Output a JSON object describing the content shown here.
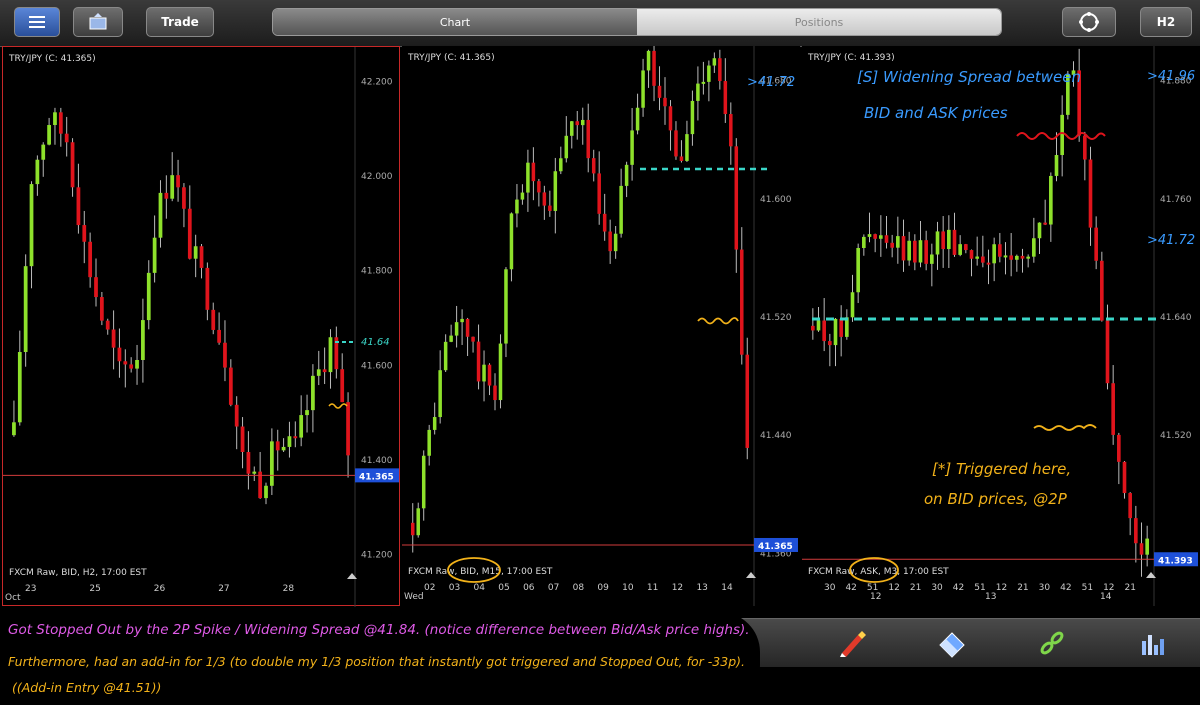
{
  "toolbar": {
    "trade_label": "Trade",
    "tab_chart": "Chart",
    "tab_positions": "Positions",
    "timeframe_label": "H2"
  },
  "colors": {
    "bull": "#8ee12b",
    "bear": "#e0141c",
    "price_line": "#d23c3c",
    "price_tag": "#1e50d8"
  },
  "chart_data": [
    {
      "type": "candlestick",
      "title": "TRY/JPY (C: 41.365)",
      "footer": "FXCM Raw, BID, H2, 17:00 EST",
      "x_tick_labels": [
        "23",
        "25",
        "26",
        "27",
        "28"
      ],
      "x_first_label": "Oct",
      "y_tick_labels": [
        "42.200",
        "42.000",
        "41.800",
        "41.600",
        "41.400",
        "41.200"
      ],
      "ylim": [
        41.2,
        42.2
      ],
      "current_price": 41.365,
      "current_price_label": "41.365",
      "annotations": [
        "41.64"
      ]
    },
    {
      "type": "candlestick",
      "title": "TRY/JPY (C: 41.365)",
      "footer": "FXCM Raw, BID, M15, 17:00 EST",
      "x_tick_labels": [
        "02",
        "03",
        "04",
        "05",
        "06",
        "07",
        "08",
        "09",
        "10",
        "11",
        "12",
        "13",
        "14"
      ],
      "x_first_label": "Wed",
      "y_tick_labels": [
        "41.680",
        "41.600",
        "41.520",
        "41.440",
        "41.360"
      ],
      "ylim": [
        41.36,
        41.68
      ],
      "current_price": 41.365,
      "current_price_label": "41.365",
      "annotations": [
        "41.72"
      ]
    },
    {
      "type": "candlestick",
      "title": "TRY/JPY (C: 41.393)",
      "footer": "FXCM Raw, ASK, M3, 17:00 EST",
      "x_tick_labels": [
        "30",
        "42",
        "51",
        "12",
        "21",
        "30",
        "42",
        "51",
        "12",
        "21",
        "30",
        "42",
        "51",
        "12",
        "21"
      ],
      "x_sub_labels": [
        "12",
        "13",
        "14"
      ],
      "y_tick_labels": [
        "41.880",
        "41.760",
        "41.640",
        "41.520"
      ],
      "ylim": [
        41.4,
        41.88
      ],
      "current_price": 41.393,
      "current_price_label": "41.393",
      "annotations": [
        "41.96",
        "41.72",
        "[S] Widening Spread between",
        "BID and ASK prices",
        "[*] Triggered here,",
        "on BID prices, @2P"
      ]
    }
  ],
  "notes": {
    "line1": "Got Stopped Out by the 2P Spike / Widening Spread @41.84. (notice difference between Bid/Ask price highs).",
    "line2": "Furthermore, had an add-in for 1/3 (to double my 1/3 position that instantly got triggered and Stopped Out, for -33p).",
    "line3": "((Add-in Entry @41.51))"
  }
}
